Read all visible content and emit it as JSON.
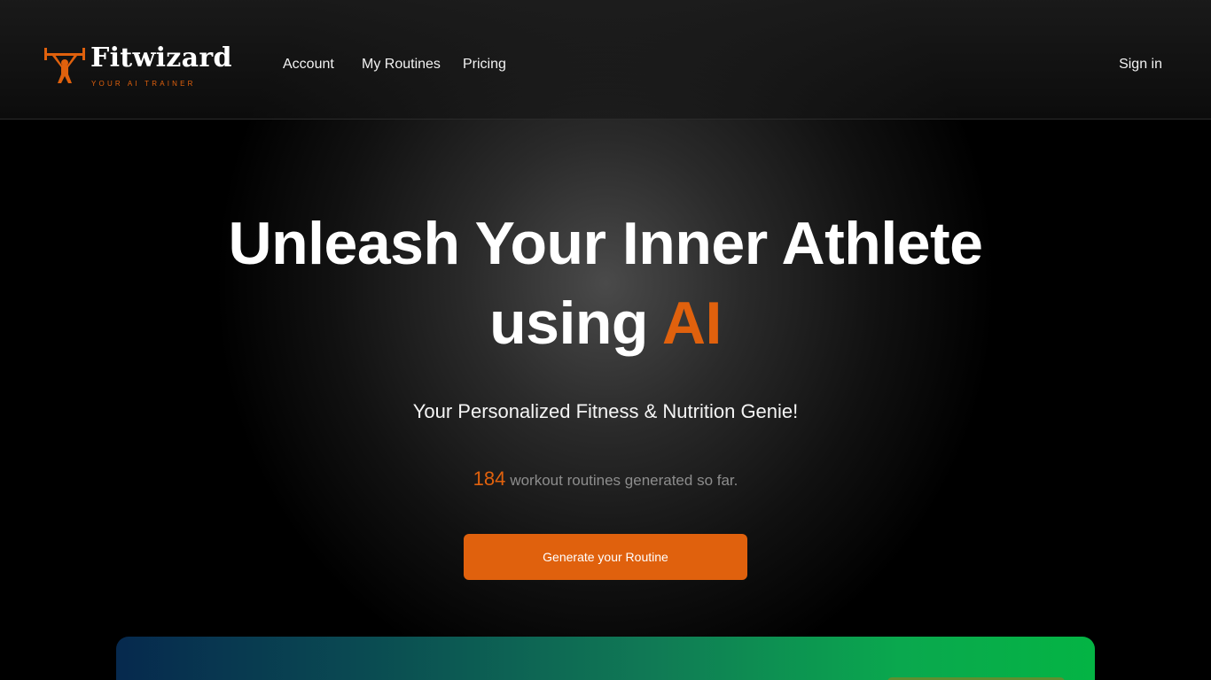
{
  "brand": {
    "name": "Fitwizard",
    "tagline": "YOUR AI TRAINER",
    "icon": "weightlifter-icon",
    "accent_color": "#e0610d"
  },
  "nav": {
    "items": [
      {
        "label": "Account"
      },
      {
        "label": "My Routines"
      },
      {
        "label": "Pricing"
      }
    ],
    "sign_in": "Sign in"
  },
  "hero": {
    "title_line1": "Unleash Your Inner Athlete",
    "title_line2_prefix": "using",
    "title_line2_accent": "AI",
    "subtitle": "Your Personalized Fitness & Nutrition Genie!",
    "stat_count": "184",
    "stat_text": "workout routines generated so far.",
    "cta_label": "Generate your Routine"
  },
  "colors": {
    "background": "#000000",
    "cta": "#e0610d",
    "banner_start": "#06294e",
    "banner_end": "#04b444"
  }
}
